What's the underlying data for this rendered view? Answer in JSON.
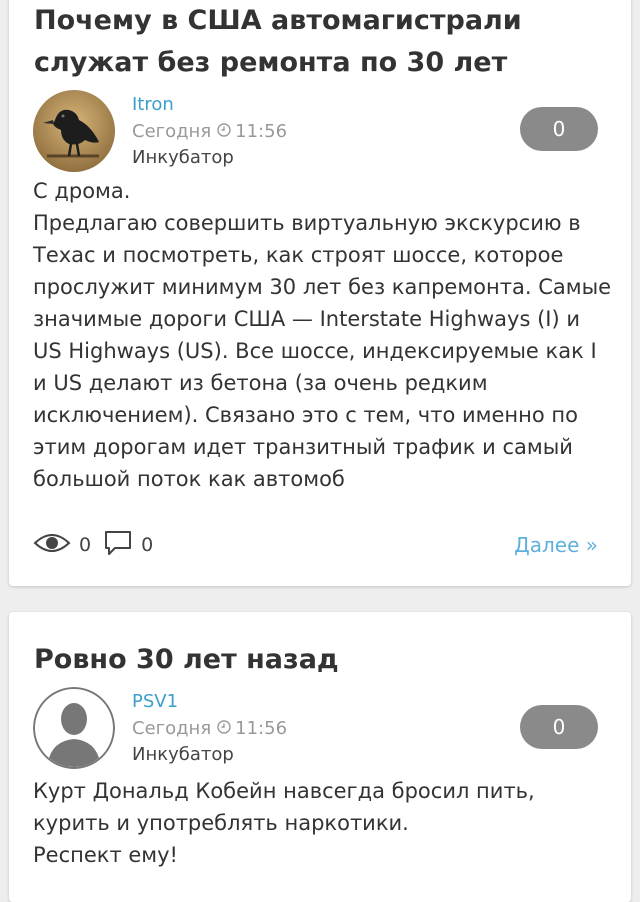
{
  "posts": [
    {
      "title": "Почему в США автомагистрали служат без ремонта по 30 лет",
      "author": "Itron",
      "date_label": "Сегодня",
      "time": "11:56",
      "category": "Инкубатор",
      "rating": "0",
      "body": "С дрома.\nПредлагаю совершить виртуальную экскурсию в Техас и посмотреть, как строят шоссе, которое прослужит минимум 30 лет без капремонта. Самые значимые дороги США — Interstate Highways (I) и US Highways (US). Все шоссе, индексируемые как I и US делают из бетона (за очень редким исключением). Связано это с тем, что именно по этим дорогам идет транзитный трафик и самый большой поток как автомоб",
      "views": "0",
      "comments": "0",
      "more_label": "Далее »"
    },
    {
      "title": "Ровно 30 лет назад",
      "author": "PSV1",
      "date_label": "Сегодня",
      "time": "11:56",
      "category": "Инкубатор",
      "rating": "0",
      "body": "Курт Дональд Кобейн навсегда бросил пить, курить и употреблять наркотики.\nРеспект ему!"
    }
  ],
  "colors": {
    "author_link": "#3a9fca",
    "more_link": "#5fb0dc",
    "rating_pill": "#8a8a8a",
    "page_bg": "#eeeeee"
  }
}
